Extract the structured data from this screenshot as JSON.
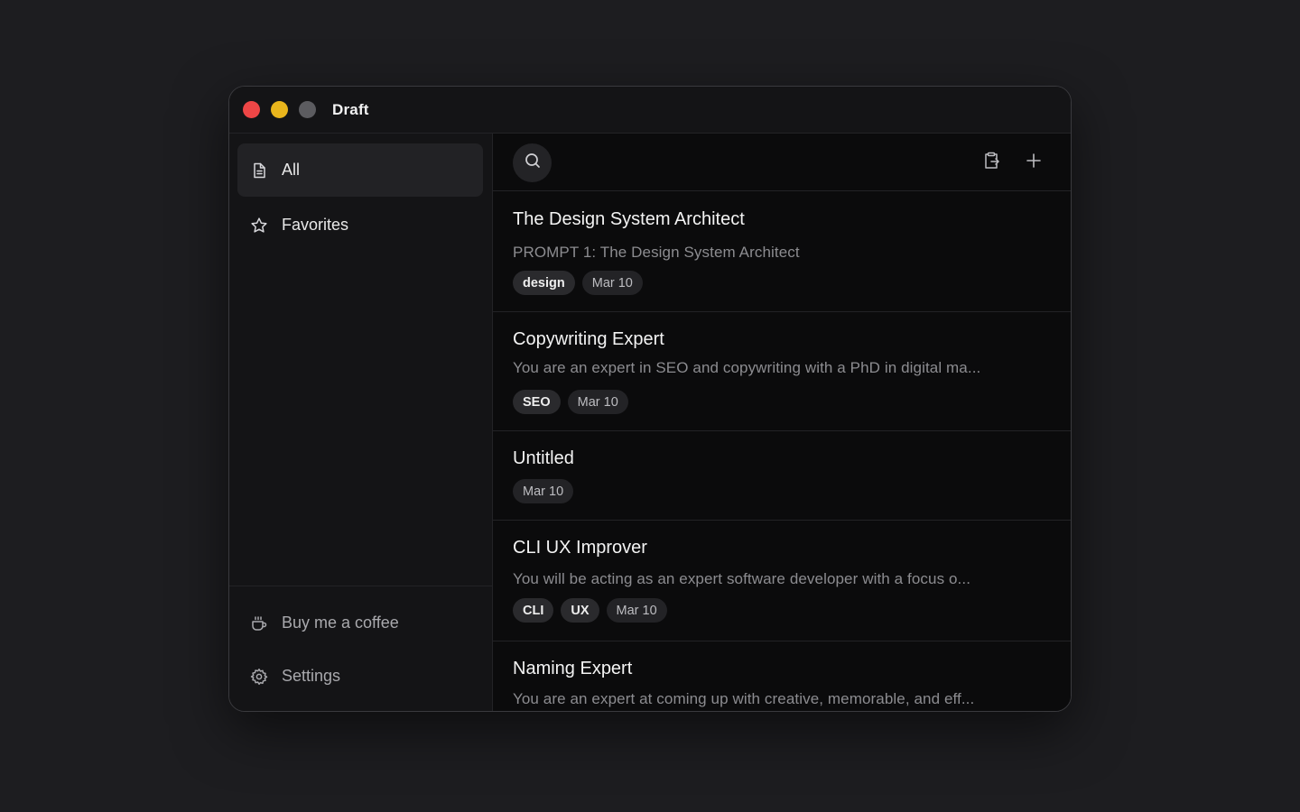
{
  "window": {
    "title": "Draft"
  },
  "sidebar": {
    "nav": [
      {
        "label": "All",
        "icon": "document-icon",
        "active": true
      },
      {
        "label": "Favorites",
        "icon": "star-icon",
        "active": false
      }
    ],
    "footer": [
      {
        "label": "Buy me a coffee",
        "icon": "coffee-icon"
      },
      {
        "label": "Settings",
        "icon": "gear-icon"
      }
    ]
  },
  "toolbar": {
    "search_icon": "search-icon",
    "paste_icon": "clipboard-paste-icon",
    "add_icon": "plus-icon"
  },
  "prompts": [
    {
      "title": "The Design System Architect",
      "preview": "PROMPT 1: The Design System Architect",
      "tags": [
        "design"
      ],
      "date": "Mar 10"
    },
    {
      "title": "Copywriting Expert",
      "preview": "You are an expert in SEO and copywriting with a PhD in digital ma...",
      "tags": [
        "SEO"
      ],
      "date": "Mar 10"
    },
    {
      "title": "Untitled",
      "preview": "",
      "tags": [],
      "date": "Mar 10"
    },
    {
      "title": "CLI UX Improver",
      "preview": "You will be acting as an expert software developer with a focus o...",
      "tags": [
        "CLI",
        "UX"
      ],
      "date": "Mar 10"
    },
    {
      "title": "Naming Expert",
      "preview": "You are an expert at coming up with creative, memorable, and eff...",
      "tags": [],
      "date": ""
    }
  ]
}
